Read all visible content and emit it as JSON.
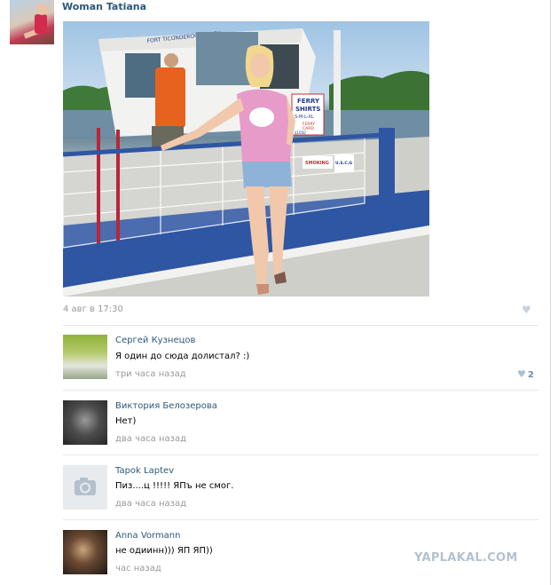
{
  "post": {
    "author": "Woman Tatiana",
    "date": "4 авг в 17:30"
  },
  "photo_signs": {
    "boat": "FORT TICONDEROGA FERRY",
    "board_line1": "FERRY",
    "board_line2": "SHIRTS",
    "board_line3": "S-M-L-XL",
    "board_line4": "FERRY",
    "board_line5": "CARD",
    "board_line6": "$1650",
    "sign_smoking": "SMOKING",
    "sign_uscg": "U.S.C.G"
  },
  "comments": [
    {
      "name": "Сергей Кузнецов",
      "text": "Я один до сюда долистал? :)",
      "time": "три часа назад",
      "likes": "2"
    },
    {
      "name": "Виктория Белозерова",
      "text": "Нет)",
      "time": "два часа назад"
    },
    {
      "name": "Tapok Laptev",
      "text": "Пиз....ц !!!!! ЯПъ не смог.",
      "time": "два часа назад"
    },
    {
      "name": "Anna Vormann",
      "text": "не одиинн))) ЯП ЯП))",
      "time": "час назад"
    }
  ],
  "watermark": "YAPLAKAL.COM",
  "colors": {
    "link": "#2b587a",
    "meta": "#999999",
    "separator": "#e7e8ec"
  },
  "icons": {
    "like": "heart-icon",
    "camera": "camera-icon"
  }
}
